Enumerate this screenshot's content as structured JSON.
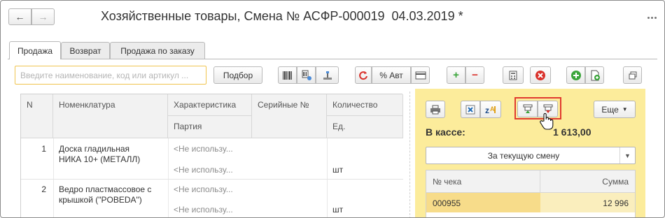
{
  "window": {
    "title": "Хозяйственные товары, Смена № АСФР-000019  04.03.2019 *",
    "back_arrow": "←",
    "forward_arrow": "→"
  },
  "tabs": [
    {
      "label": "Продажа",
      "active": true
    },
    {
      "label": "Возврат",
      "active": false
    },
    {
      "label": "Продажа по заказу",
      "active": false
    }
  ],
  "toolbar": {
    "search_placeholder": "Введите наименование, код или артикул ...",
    "podbor_label": "Подбор",
    "discount_label": "% Авт",
    "plus": "+",
    "minus": "−"
  },
  "grid": {
    "headers": {
      "n": "N",
      "nomenclature": "Номенклатура",
      "characteristic": "Характеристика",
      "serial": "Серийные №",
      "quantity": "Количество",
      "party": "Партия",
      "unit": "Ед."
    },
    "rows": [
      {
        "n": "1",
        "name_line1": "Доска гладильная",
        "name_line2": "НИКА 10+ (МЕТАЛЛ)",
        "characteristic": "<Не использу...",
        "party": "<Не использу...",
        "unit": "шт"
      },
      {
        "n": "2",
        "name_line1": "Ведро пластмассовое с",
        "name_line2": "крышкой (\"POBEDA\")",
        "characteristic": "<Не использу...",
        "party": "<Не использу...",
        "unit": "шт"
      }
    ]
  },
  "panel": {
    "more_label": "Еще",
    "kassa_label": "В кассе:",
    "kassa_value": "1 613,00",
    "period_select": "За текущую смену",
    "receipts": {
      "col_number": "№ чека",
      "col_sum": "Сумма",
      "rows": [
        {
          "number": "000955",
          "sum": "12 996"
        }
      ]
    }
  },
  "colors": {
    "panel_bg": "#fcec9b",
    "highlight": "#e03a2f",
    "search_border": "#f0c44e",
    "add_green": "#3aa53a",
    "remove_red": "#d9312b"
  }
}
